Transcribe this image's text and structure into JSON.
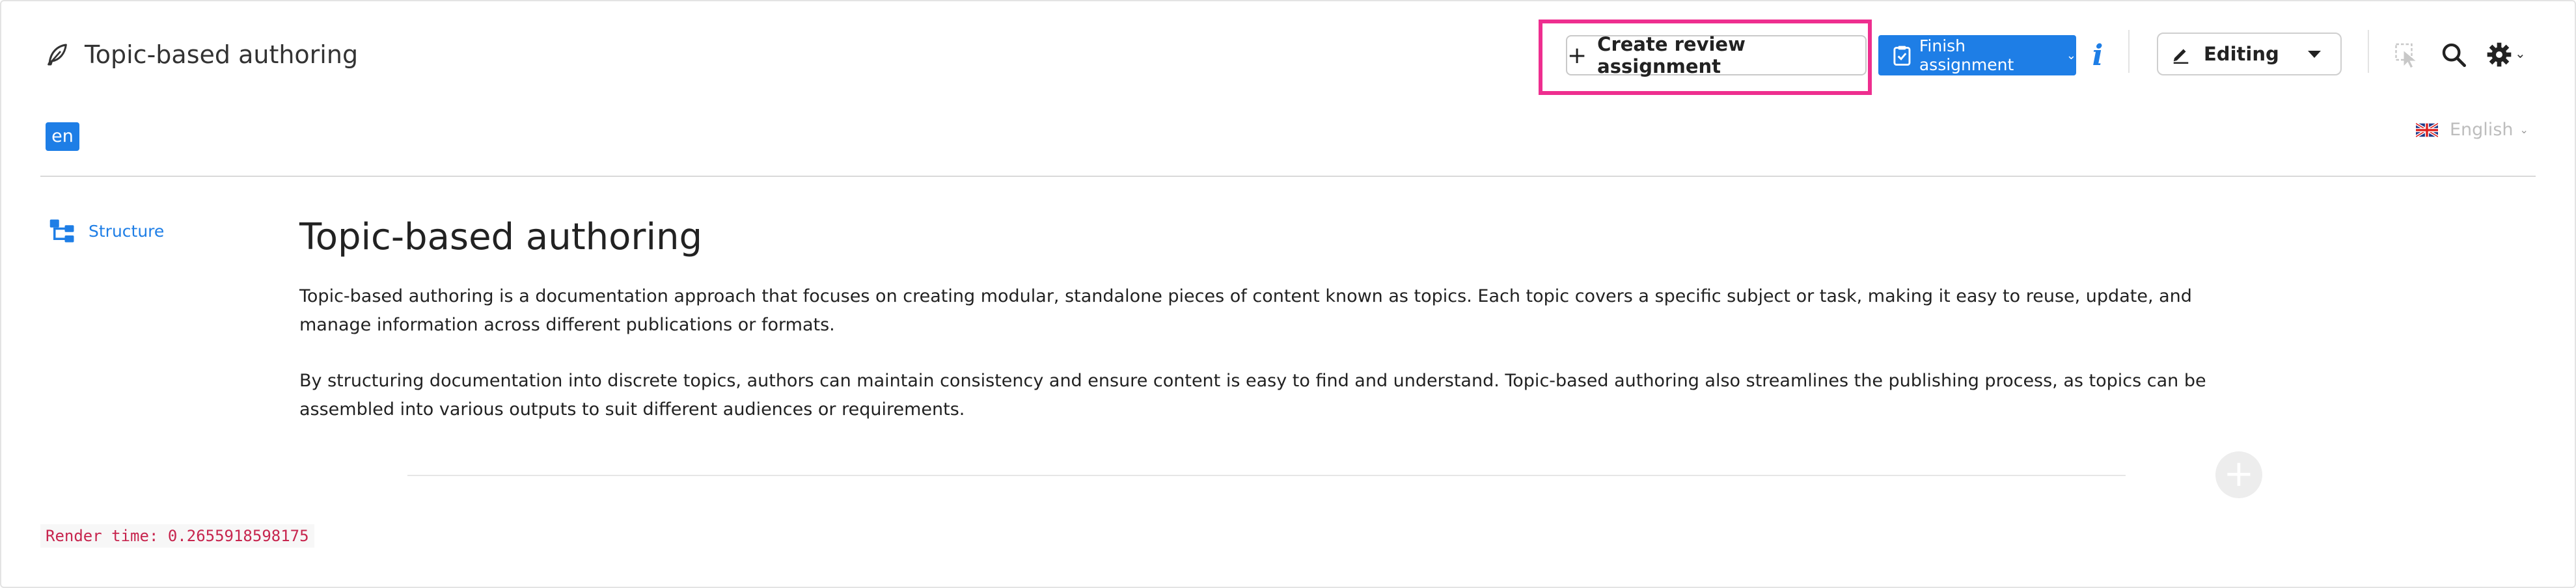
{
  "header": {
    "title": "Topic-based authoring",
    "create_review_label": "Create review assignment",
    "finish_assignment_label": "Finish assignment",
    "info_glyph": "i",
    "mode_label": "Editing"
  },
  "language": {
    "badge": "en",
    "selected": "English"
  },
  "sidebar": {
    "structure_label": "Structure"
  },
  "content": {
    "heading": "Topic-based authoring",
    "paragraphs": [
      "Topic-based authoring is a documentation approach that focuses on creating modular, standalone pieces of content known as topics. Each topic covers a specific subject or task, making it easy to reuse, update, and manage information across different publications or formats.",
      "By structuring documentation into discrete topics, authors can maintain consistency and ensure content is easy to find and understand. Topic-based authoring also streamlines the publishing process, as topics can be assembled into various outputs to suit different audiences or requirements."
    ]
  },
  "add_block_glyph": "+",
  "debug": {
    "render_time": "Render time: 0.2655918598175"
  },
  "colors": {
    "accent": "#1e7ee6",
    "highlight": "#ee2e8f",
    "debug_text": "#c7254e"
  },
  "icons": [
    "feather-icon",
    "plus-icon",
    "clipboard-check-icon",
    "chevron-down-icon",
    "info-icon",
    "pencil-icon",
    "caret-down-icon",
    "cursor-select-icon",
    "search-icon",
    "gear-icon",
    "uk-flag-icon",
    "structure-tree-icon"
  ]
}
